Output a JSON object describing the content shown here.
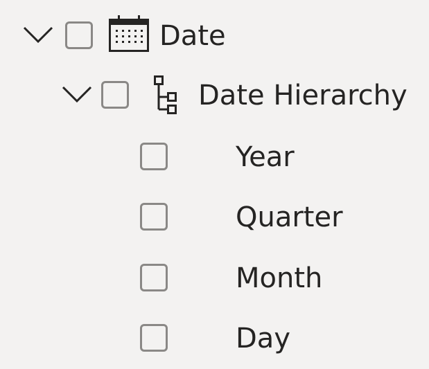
{
  "tree": {
    "table": {
      "label": "Date",
      "icon": "calendar-icon",
      "expanded": true,
      "checked": false
    },
    "hierarchy": {
      "label": "Date Hierarchy",
      "icon": "hierarchy-icon",
      "expanded": true,
      "checked": false
    },
    "levels": [
      {
        "label": "Year",
        "checked": false
      },
      {
        "label": "Quarter",
        "checked": false
      },
      {
        "label": "Month",
        "checked": false
      },
      {
        "label": "Day",
        "checked": false
      }
    ]
  },
  "colors": {
    "background": "#f3f2f1",
    "text": "#252423",
    "checkbox_border": "#8a8886",
    "icon": "#252423"
  }
}
